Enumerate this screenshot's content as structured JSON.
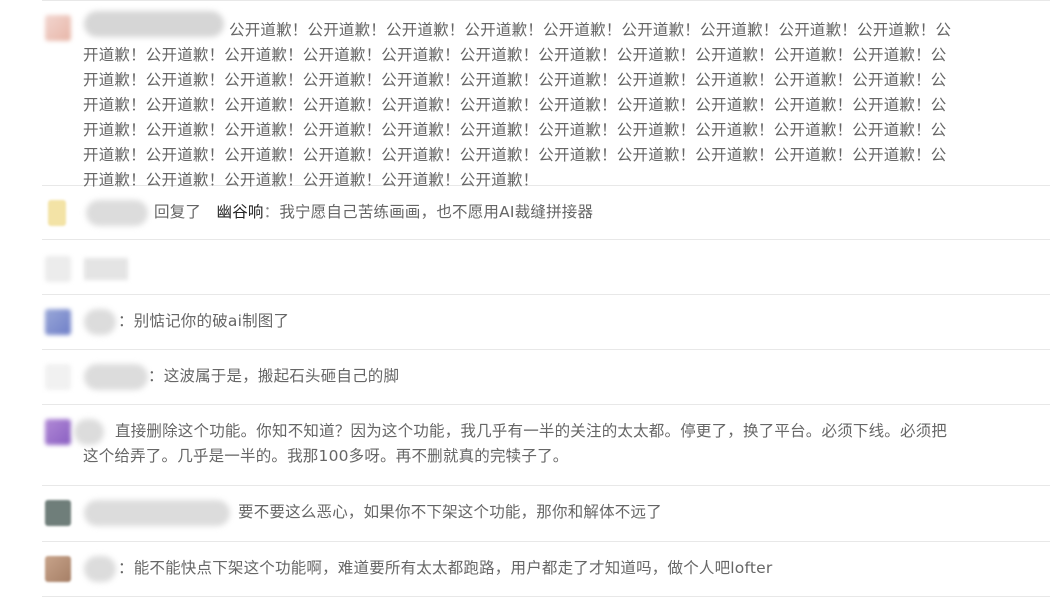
{
  "comments": [
    {
      "text": "公开道歉！公开道歉！公开道歉！公开道歉！公开道歉！公开道歉！公开道歉！公开道歉！公开道歉！公开道歉！公开道歉！公开道歉！公开道歉！公开道歉！公开道歉！公开道歉！公开道歉！公开道歉！公开道歉！公开道歉！公开道歉！公开道歉！公开道歉！公开道歉！公开道歉！公开道歉！公开道歉！公开道歉！公开道歉！公开道歉！公开道歉！公开道歉！公开道歉！公开道歉！公开道歉！公开道歉！公开道歉！公开道歉！公开道歉！公开道歉！公开道歉！公开道歉！公开道歉！公开道歉！公开道歉！公开道歉！公开道歉！公开道歉！公开道歉！公开道歉！公开道歉！公开道歉！公开道歉！公开道歉！公开道歉！公开道歉！公开道歉！公开道歉！公开道歉！公开道歉！公开道歉！公开道歉！公开道歉！公开道歉！公开道歉！公开道歉！公开道歉！公开道歉！公开道歉！公开道歉！"
    },
    {
      "reply_word": "回复了",
      "reply_to": "幽谷响",
      "colon": "：",
      "text": "我宁愿自己苦练画画，也不愿用AI裁缝拼接器"
    },
    {
      "text": ""
    },
    {
      "text": "：别惦记你的破ai制图了"
    },
    {
      "text": "：这波属于是，搬起石头砸自己的脚"
    },
    {
      "text": "直接删除这个功能。你知不知道？因为这个功能，我几乎有一半的关注的太太都。停更了，换了平台。必须下线。必须把这个给弄了。几乎是一半的。我那100多呀。再不删就真的完犊子了。"
    },
    {
      "text": "要不要这么恶心，如果你不下架这个功能，那你和解体不远了"
    },
    {
      "text": "：能不能快点下架这个功能啊，难道要所有太太都跑路，用户都走了才知道吗，做个人吧lofter"
    }
  ],
  "colors": {
    "text": "#666666",
    "username": "#222222",
    "divider": "#e8e8e8"
  }
}
